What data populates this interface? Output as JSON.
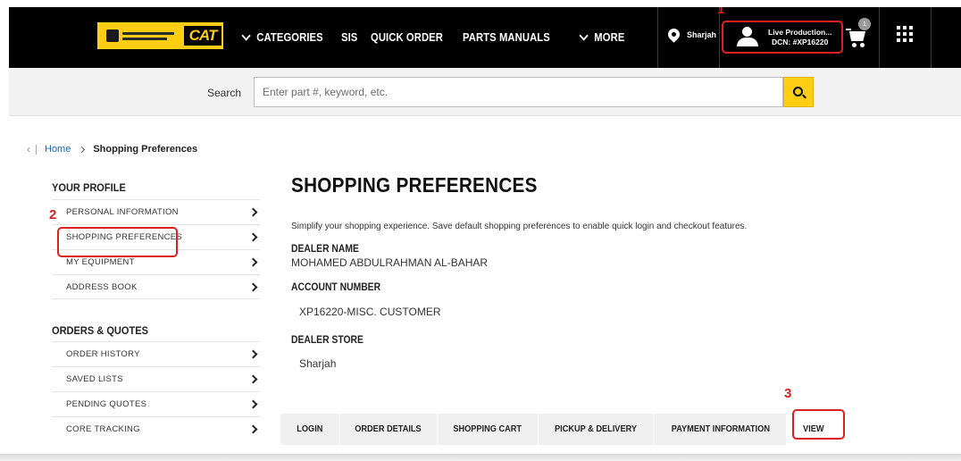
{
  "header": {
    "dealer_logo_alt": "",
    "brand": "CAT",
    "nav": [
      {
        "label": "CATEGORIES",
        "dropdown": true
      },
      {
        "label": "SIS",
        "dropdown": false
      },
      {
        "label": "QUICK ORDER",
        "dropdown": false
      },
      {
        "label": "PARTS MANUALS",
        "dropdown": false
      },
      {
        "label": "MORE",
        "dropdown": true
      }
    ],
    "location": "Sharjah",
    "user": {
      "name": "Live Production...",
      "dcn": "DCN: #XP16220"
    },
    "cart_count": "1",
    "icons": {
      "location": "map-pin-icon",
      "user": "user-icon",
      "cart": "cart-icon",
      "apps": "apps-grid-icon",
      "search": "search-icon"
    },
    "colors": {
      "nav_bg": "#000000",
      "accent": "#ffcd11"
    }
  },
  "search": {
    "label": "Search",
    "placeholder": "Enter part #, keyword, etc.",
    "value": ""
  },
  "breadcrumb": {
    "home": "Home",
    "current": "Shopping Preferences"
  },
  "sidebar": {
    "profile_heading": "YOUR PROFILE",
    "profile_items": [
      {
        "label": "PERSONAL INFORMATION"
      },
      {
        "label": "SHOPPING PREFERENCES"
      },
      {
        "label": "MY EQUIPMENT"
      },
      {
        "label": "ADDRESS BOOK"
      }
    ],
    "orders_heading": "ORDERS & QUOTES",
    "orders_items": [
      {
        "label": "ORDER HISTORY"
      },
      {
        "label": "SAVED LISTS"
      },
      {
        "label": "PENDING QUOTES"
      },
      {
        "label": "CORE TRACKING"
      }
    ]
  },
  "main": {
    "title": "SHOPPING PREFERENCES",
    "intro": "Simplify your shopping experience. Save default shopping preferences to enable quick login and checkout features.",
    "dealer_name_label": "DEALER NAME",
    "dealer_name": "MOHAMED ABDULRAHMAN AL-BAHAR",
    "account_number_label": "ACCOUNT NUMBER",
    "account_number": "XP16220-MISC. CUSTOMER",
    "dealer_store_label": "DEALER STORE",
    "dealer_store": "Sharjah",
    "tabs": [
      {
        "label": "LOGIN"
      },
      {
        "label": "ORDER DETAILS"
      },
      {
        "label": "SHOPPING CART"
      },
      {
        "label": "PICKUP & DELIVERY"
      },
      {
        "label": "PAYMENT INFORMATION"
      },
      {
        "label": "VIEW"
      }
    ]
  },
  "annotations": {
    "step1": "1",
    "step2": "2",
    "step3": "3",
    "color": "#e02020"
  }
}
